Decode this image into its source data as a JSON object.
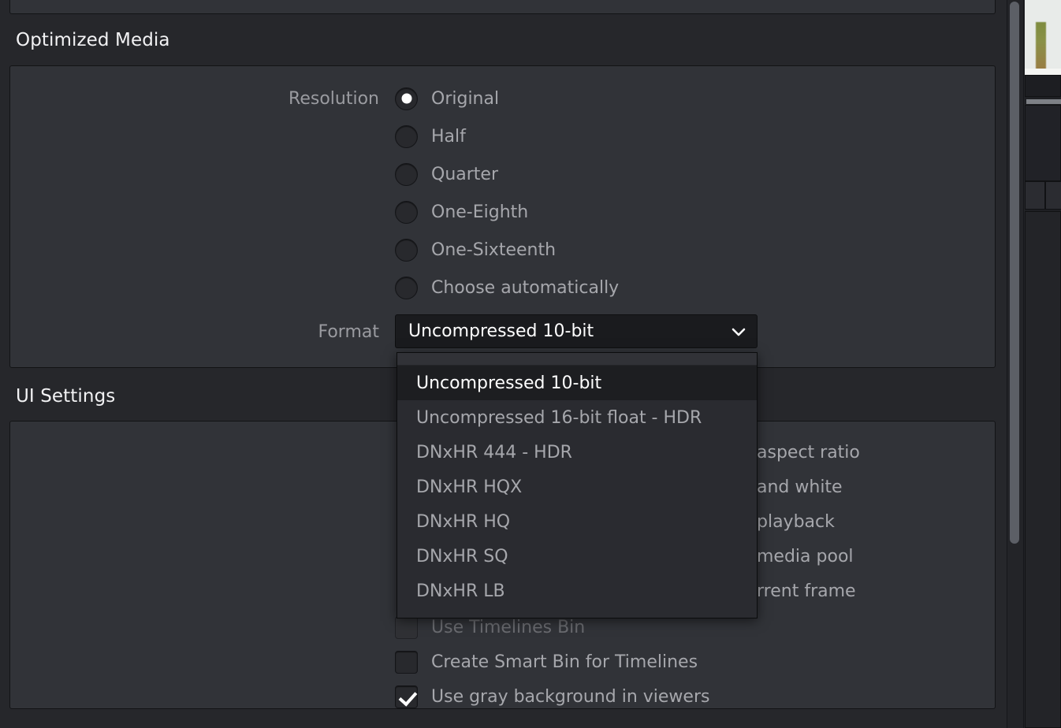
{
  "window": {
    "background_color": "#26272b",
    "panel_color": "#313338",
    "accent_text": "#ffffff",
    "muted_text": "#a6a7ac"
  },
  "sections": [
    {
      "id": "optimized-media",
      "title": "Optimized Media"
    },
    {
      "id": "ui-settings",
      "title": "UI Settings"
    }
  ],
  "optimized_media": {
    "resolution": {
      "label": "Resolution",
      "selected": "Original",
      "options": [
        {
          "label": "Original",
          "checked": true
        },
        {
          "label": "Half",
          "checked": false
        },
        {
          "label": "Quarter",
          "checked": false
        },
        {
          "label": "One-Eighth",
          "checked": false
        },
        {
          "label": "One-Sixteenth",
          "checked": false
        },
        {
          "label": "Choose automatically",
          "checked": false
        }
      ]
    },
    "format": {
      "label": "Format",
      "value": "Uncompressed 10-bit",
      "chevron_icon": "chevron-down-icon",
      "expanded": true,
      "options": [
        {
          "label": "Uncompressed 10-bit",
          "selected": true
        },
        {
          "label": "Uncompressed 16-bit float - HDR",
          "selected": false
        },
        {
          "label": "DNxHR 444 - HDR",
          "selected": false
        },
        {
          "label": "DNxHR HQX",
          "selected": false
        },
        {
          "label": "DNxHR HQ",
          "selected": false
        },
        {
          "label": "DNxHR SQ",
          "selected": false
        },
        {
          "label": "DNxHR LB",
          "selected": false
        }
      ]
    }
  },
  "ui_settings": {
    "occluded_tail_labels": [
      "aspect ratio",
      "and white",
      "playback",
      "media pool",
      "rrent frame"
    ],
    "checkboxes": [
      {
        "label": "Use Timelines Bin",
        "checked": false,
        "disabled": true
      },
      {
        "label": "Create Smart Bin for Timelines",
        "checked": false,
        "disabled": false
      },
      {
        "label": "Use gray background in viewers",
        "checked": true,
        "disabled": false
      }
    ]
  },
  "scrollbar": {
    "orientation": "vertical",
    "thumb_color": "#5c5f66"
  }
}
